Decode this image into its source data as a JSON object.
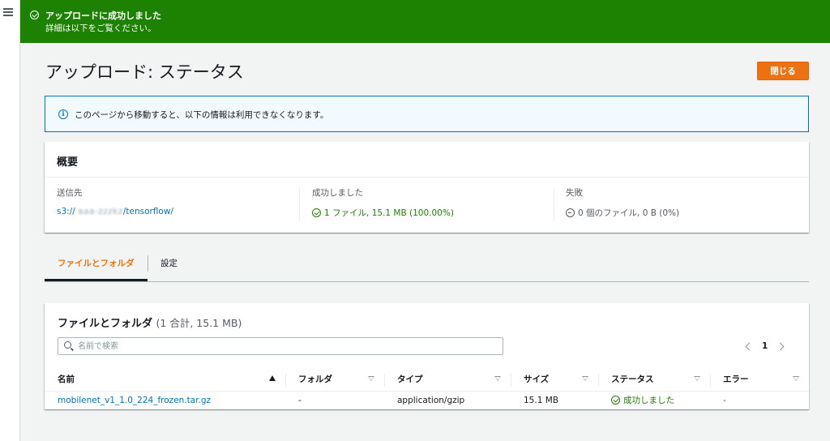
{
  "flash": {
    "title": "アップロードに成功しました",
    "description": "詳細は以下をご覧ください。"
  },
  "page": {
    "title": "アップロード: ステータス",
    "close_label": "閉じる"
  },
  "info": {
    "text": "このページから移動すると、以下の情報は利用できなくなります。"
  },
  "summary": {
    "title": "概要",
    "destination_label": "送信先",
    "destination_prefix": "s3://",
    "destination_hidden": "aaa-zzzkz",
    "destination_suffix": "/tensorflow/",
    "succeeded_label": "成功しました",
    "succeeded_value": "1 ファイル, 15.1 MB (100.00%)",
    "failed_label": "失敗",
    "failed_value": "0 個のファイル, 0 B (0%)"
  },
  "tabs": [
    {
      "label": "ファイルとフォルダ",
      "active": true
    },
    {
      "label": "設定",
      "active": false
    }
  ],
  "files": {
    "title": "ファイルとフォルダ",
    "count": "(1 合計, 15.1 MB)",
    "search_placeholder": "名前で検索",
    "page": "1",
    "columns": [
      "名前",
      "フォルダ",
      "タイプ",
      "サイズ",
      "ステータス",
      "エラー"
    ],
    "rows": [
      {
        "name": "mobilenet_v1_1.0_224_frozen.tar.gz",
        "folder": "-",
        "type": "application/gzip",
        "size": "15.1 MB",
        "status": "成功しました",
        "error": "-"
      }
    ]
  },
  "colors": {
    "success": "#1d8102",
    "primary_button": "#ec7211",
    "link": "#0073bb"
  },
  "icons": [
    "menu-icon",
    "success-icon",
    "info-icon",
    "search-icon",
    "chevron-left-icon",
    "chevron-right-icon",
    "sort-ascending-icon",
    "sort-icon"
  ]
}
